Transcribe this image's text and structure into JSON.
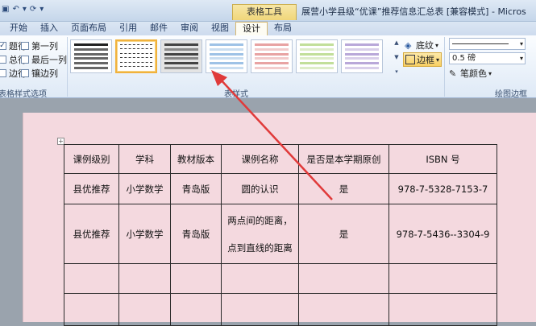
{
  "window": {
    "title": "展营小学县级“优课”推荐信息汇总表 [兼容模式] - Micros",
    "contextual_tools_label": "表格工具"
  },
  "tabs": [
    "开始",
    "插入",
    "页面布局",
    "引用",
    "邮件",
    "审阅",
    "视图",
    "设计",
    "布局"
  ],
  "active_tab": "设计",
  "ribbon": {
    "style_options": {
      "items": [
        {
          "label": "题行",
          "checked": true
        },
        {
          "label": "第一列",
          "checked": false
        },
        {
          "label": "总行",
          "checked": false
        },
        {
          "label": "最后一列",
          "checked": false
        },
        {
          "label": "边行",
          "checked": false
        },
        {
          "label": "镶边列",
          "checked": false
        }
      ],
      "group_label": "表格样式选项"
    },
    "styles_group_label": "表样式",
    "shading_label": "底纹",
    "borders_label": "边框",
    "line_weight": "0.5 磅",
    "pen_color_label": "笔颜色",
    "draw_borders_group_label": "绘图边框",
    "swatch_colors": [
      "#5a5a5a",
      "#ffffff",
      "#8c8c8c",
      "#9ec2e6",
      "#e8a3a3",
      "#c2df9a",
      "#b9a8d9",
      "#8fd4e3"
    ]
  },
  "table": {
    "headers": [
      "课例级别",
      "学科",
      "教材版本",
      "课例名称",
      "是否是本学期原创",
      "ISBN 号"
    ],
    "rows": [
      [
        "县优推荐",
        "小学数学",
        "青岛版",
        "圆的认识",
        "是",
        "978-7-5328-7153-7"
      ],
      [
        "县优推荐",
        "小学数学",
        "青岛版",
        "两点间的距离，",
        "是",
        "978-7-5436--3304-9"
      ],
      [
        "",
        "",
        "",
        "",
        "",
        ""
      ],
      [
        "",
        "",
        "",
        "",
        "",
        ""
      ]
    ],
    "row2_name_line2": "点到直线的距离"
  },
  "colors": {
    "page_background": "#f4d9df",
    "annotation_arrow": "#e03a3a",
    "selected_style_border": "#f1b23c"
  }
}
